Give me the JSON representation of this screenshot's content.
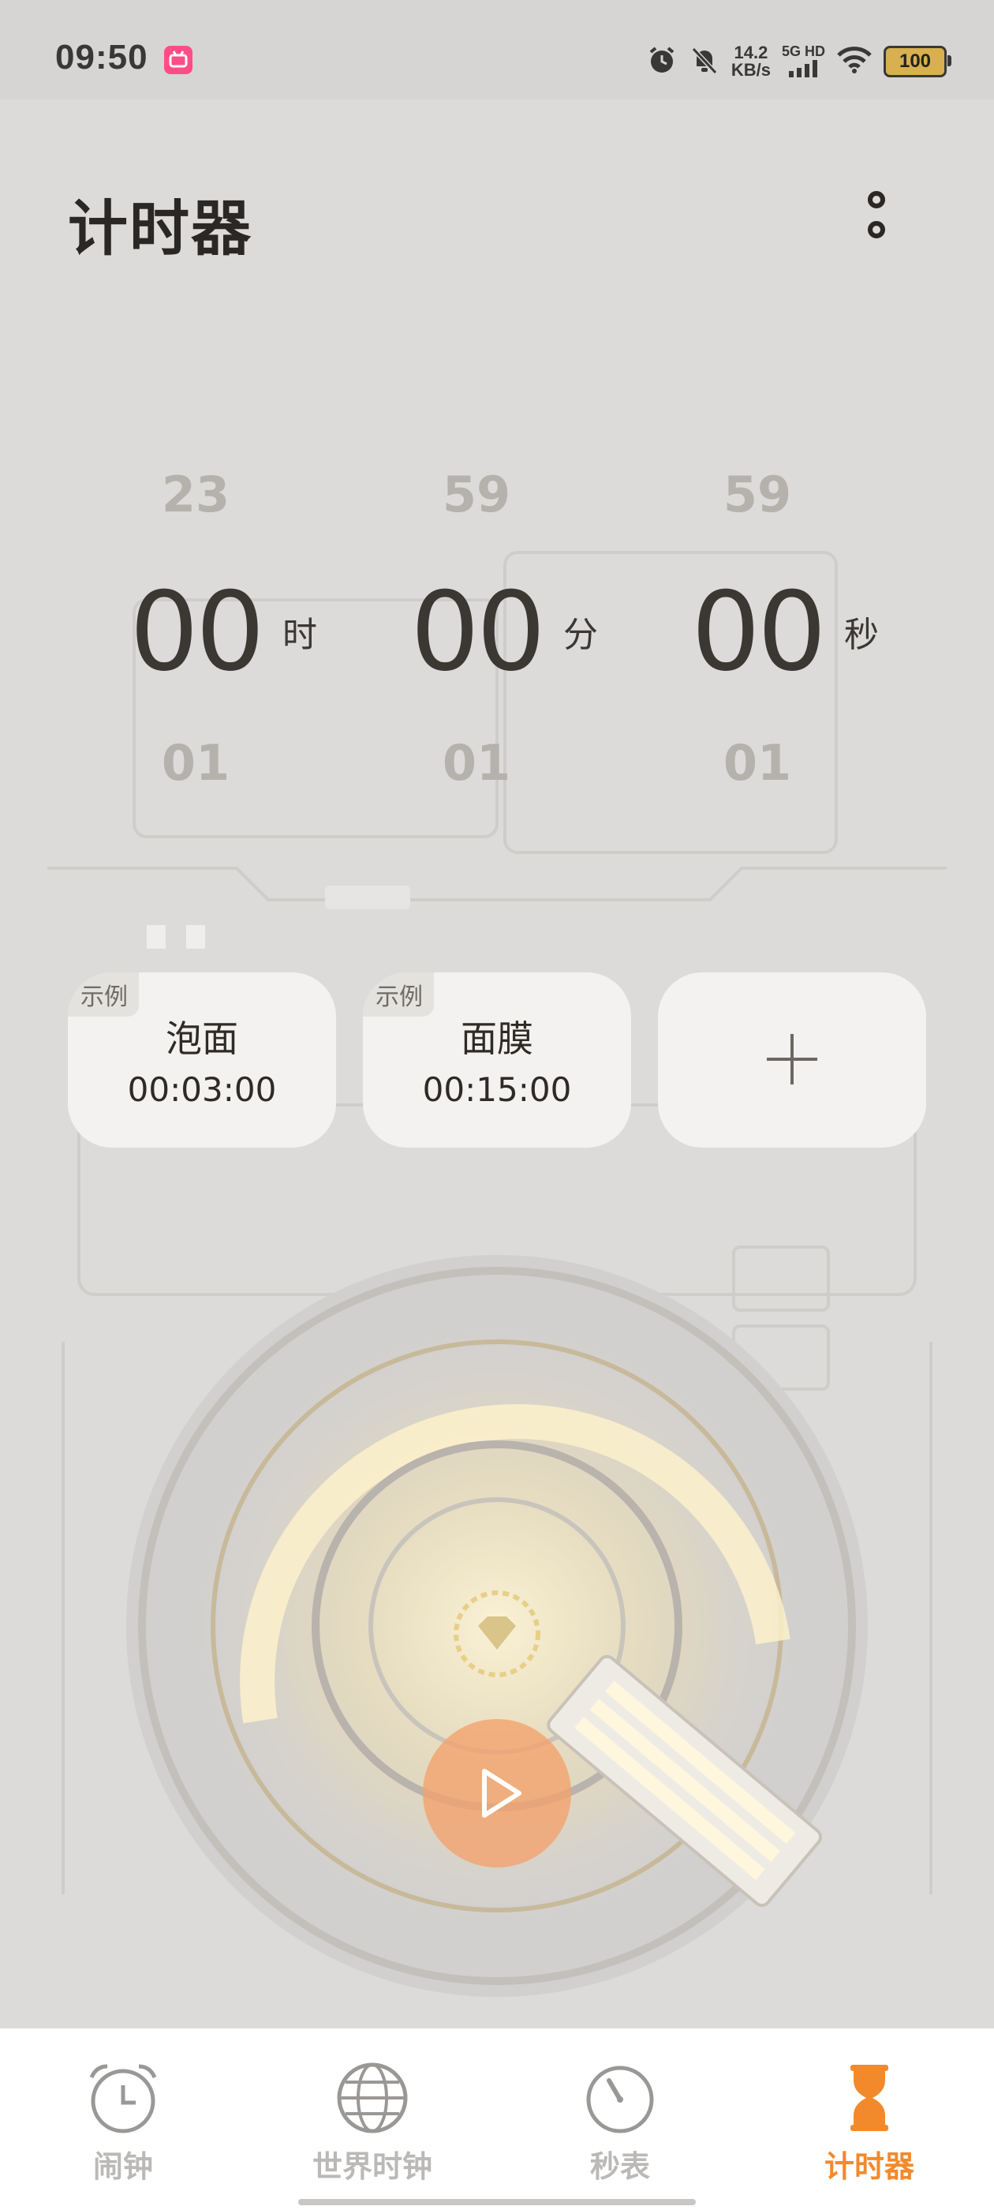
{
  "status_bar": {
    "time": "09:50",
    "app_icon": "bilibili-icon",
    "net_speed_value": "14.2",
    "net_speed_unit": "KB/s",
    "network_label": "5G HD",
    "battery_level": "100",
    "icons": [
      "alarm-icon",
      "mute-bell-icon",
      "signal-icon",
      "wifi-icon",
      "battery-icon"
    ]
  },
  "header": {
    "title": "计时器",
    "menu_icon": "more-options-icon"
  },
  "time_picker": {
    "hours": {
      "prev": "23",
      "current": "00",
      "next": "01",
      "unit": "时"
    },
    "minutes": {
      "prev": "59",
      "current": "00",
      "next": "01",
      "unit": "分"
    },
    "seconds": {
      "prev": "59",
      "current": "00",
      "next": "01",
      "unit": "秒"
    }
  },
  "presets": [
    {
      "tag": "示例",
      "name": "泡面",
      "duration": "00:03:00"
    },
    {
      "tag": "示例",
      "name": "面膜",
      "duration": "00:15:00"
    }
  ],
  "add_preset_icon": "plus-icon",
  "play_button_icon": "play-icon",
  "bottom_nav": {
    "items": [
      {
        "label": "闹钟",
        "icon": "alarm-clock-icon",
        "active": false
      },
      {
        "label": "世界时钟",
        "icon": "globe-icon",
        "active": false
      },
      {
        "label": "秒表",
        "icon": "stopwatch-icon",
        "active": false
      },
      {
        "label": "计时器",
        "icon": "hourglass-icon",
        "active": true
      }
    ]
  },
  "colors": {
    "accent": "#f28a2c",
    "background": "#dcdbda",
    "text_primary": "#2e2a26",
    "text_muted": "#b5b1ac",
    "card_background": "#f3f2f0",
    "nav_inactive": "#bbb9b7"
  }
}
